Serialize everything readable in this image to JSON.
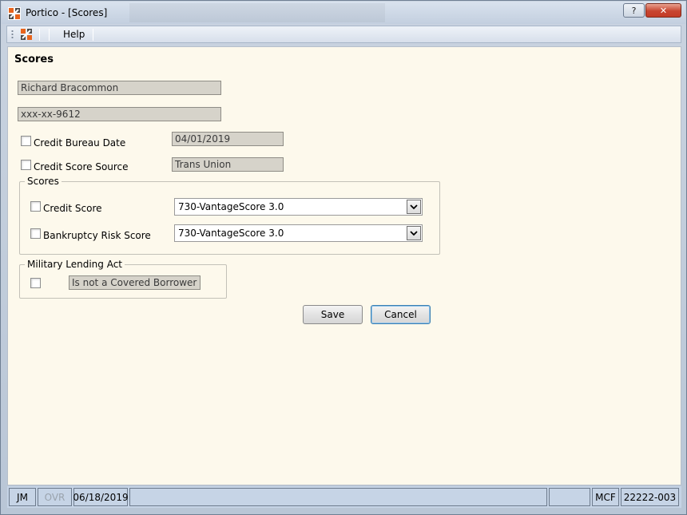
{
  "window": {
    "title": "Portico - [Scores]",
    "help_button": "?",
    "close_button": "✕"
  },
  "menu": {
    "help": "Help"
  },
  "page": {
    "title": "Scores"
  },
  "borrower": {
    "name": "Richard Bracommon",
    "ssn": "xxx-xx-9612"
  },
  "credit_bureau_date": {
    "label": "Credit Bureau Date",
    "value": "04/01/2019",
    "checked": false
  },
  "credit_score_source": {
    "label": "Credit Score Source",
    "value": "Trans Union",
    "checked": false
  },
  "scores_group": {
    "title": "Scores",
    "credit_score": {
      "label": "Credit Score",
      "selected": "730-VantageScore 3.0",
      "checked": false
    },
    "bankruptcy_risk_score": {
      "label": "Bankruptcy Risk Score",
      "selected": "730-VantageScore 3.0",
      "checked": false
    }
  },
  "mla_group": {
    "title": "Military Lending Act",
    "value": "Is not a Covered Borrower",
    "checked": false
  },
  "actions": {
    "save": "Save",
    "cancel": "Cancel"
  },
  "status": {
    "user": "JM",
    "ovr": "OVR",
    "date": "06/18/2019",
    "blank1": "",
    "blank2": "",
    "code": "MCF",
    "number": "22222-003"
  },
  "colors": {
    "content_background": "#fdf9ec",
    "readonly_field": "#d6d3ca",
    "statusbar": "#c6d4e6",
    "close_button": "#c84530"
  }
}
